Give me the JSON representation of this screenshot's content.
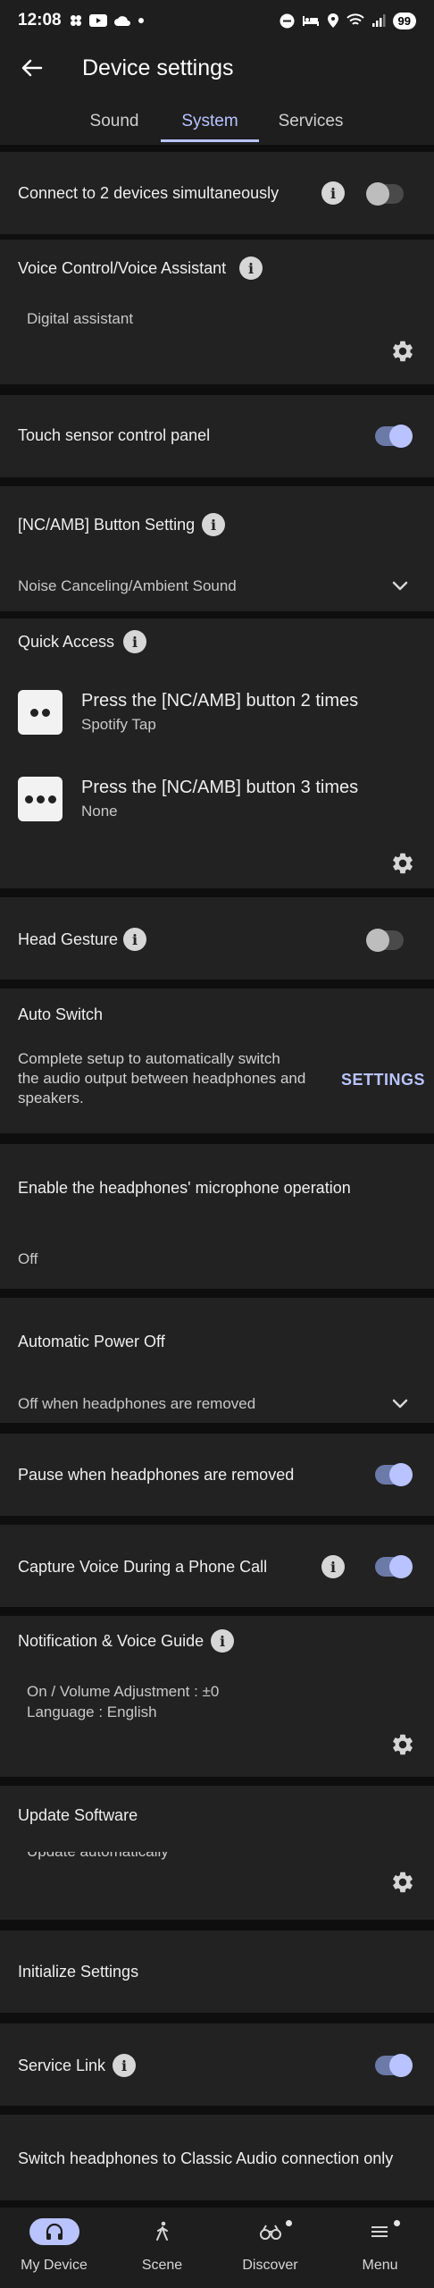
{
  "status_bar": {
    "time": "12:08",
    "battery": "99",
    "left_icons": [
      "photos-icon",
      "youtube-icon",
      "cloud-icon",
      "dot-icon"
    ],
    "right_icons": [
      "dnd-icon",
      "bed-icon",
      "location-icon",
      "wifi-icon",
      "signal-icon"
    ]
  },
  "header": {
    "title": "Device settings",
    "tabs": [
      {
        "label": "Sound",
        "active": false
      },
      {
        "label": "System",
        "active": true
      },
      {
        "label": "Services",
        "active": false
      }
    ]
  },
  "settings": {
    "connect_two": {
      "title": "Connect to 2 devices simultaneously",
      "enabled": false
    },
    "voice_control": {
      "title": "Voice Control/Voice Assistant",
      "value": "Digital assistant"
    },
    "touch_sensor": {
      "title": "Touch sensor control panel",
      "enabled": true
    },
    "nc_amb": {
      "title": "[NC/AMB] Button Setting",
      "value": "Noise Canceling/Ambient Sound"
    },
    "quick_access": {
      "title": "Quick Access",
      "items": [
        {
          "title": "Press the [NC/AMB] button 2 times",
          "value": "Spotify Tap"
        },
        {
          "title": "Press the [NC/AMB] button 3 times",
          "value": "None"
        }
      ]
    },
    "head_gesture": {
      "title": "Head Gesture",
      "enabled": false
    },
    "auto_switch": {
      "title": "Auto Switch",
      "description": [
        "Complete setup to automatically switch",
        "the audio output between headphones and",
        "speakers."
      ],
      "link": "SETTINGS"
    },
    "mic_operation": {
      "title": "Enable the headphones' microphone operation",
      "value": "Off"
    },
    "auto_power_off": {
      "title": "Automatic Power Off",
      "value": "Off when headphones are removed"
    },
    "pause_removed": {
      "title": "Pause when headphones are removed",
      "enabled": true
    },
    "capture_voice": {
      "title": "Capture Voice During a Phone Call",
      "enabled": true
    },
    "notification": {
      "title": "Notification & Voice Guide",
      "line1": "On / Volume Adjustment : ±0",
      "line2": "Language : English"
    },
    "update_software": {
      "title": "Update Software",
      "value": "Update automatically"
    },
    "initialize": {
      "title": "Initialize Settings"
    },
    "service_link": {
      "title": "Service Link",
      "enabled": true
    },
    "classic_audio": {
      "title": "Switch headphones to Classic Audio connection only"
    }
  },
  "bottom_nav": [
    {
      "label": "My Device",
      "icon": "headphones-icon",
      "active": true
    },
    {
      "label": "Scene",
      "icon": "walking-icon",
      "active": false
    },
    {
      "label": "Discover",
      "icon": "binoculars-icon",
      "active": false
    },
    {
      "label": "Menu",
      "icon": "menu-icon",
      "active": false
    }
  ],
  "colors": {
    "accent": "#b9c3ff",
    "card": "#222222",
    "background": "#0e0e0e"
  }
}
